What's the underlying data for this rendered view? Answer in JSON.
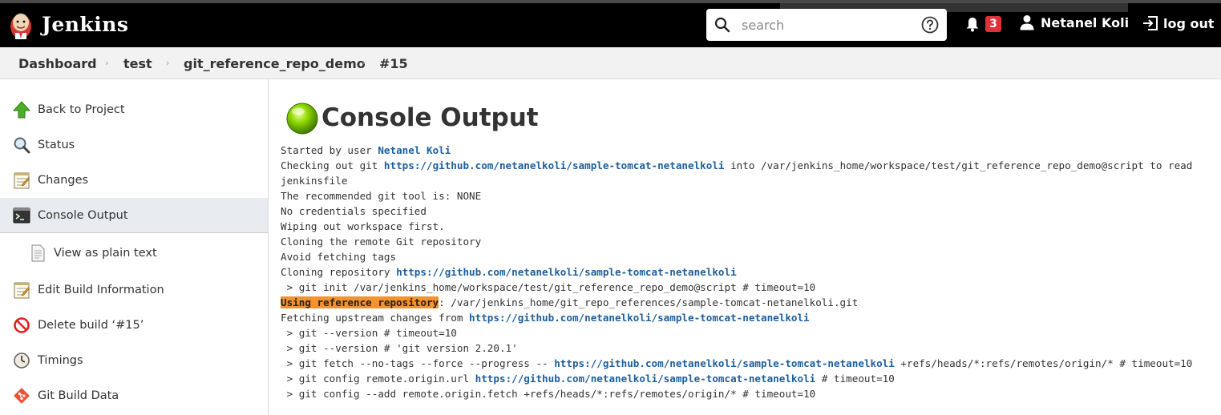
{
  "header": {
    "brand": "Jenkins",
    "search_placeholder": "search",
    "notifications_count": "3",
    "user_name": "Netanel Koli",
    "logout_label": "log out"
  },
  "breadcrumbs": [
    "Dashboard",
    "test",
    "git_reference_repo_demo",
    "#15"
  ],
  "sidebar": {
    "items": [
      {
        "label": "Back to Project",
        "icon": "up-arrow-icon"
      },
      {
        "label": "Status",
        "icon": "magnifier-icon"
      },
      {
        "label": "Changes",
        "icon": "notepad-icon"
      },
      {
        "label": "Console Output",
        "icon": "terminal-icon"
      },
      {
        "label": "View as plain text",
        "icon": "document-icon"
      },
      {
        "label": "Edit Build Information",
        "icon": "notepad-icon"
      },
      {
        "label": "Delete build ‘#15’",
        "icon": "no-entry-icon"
      },
      {
        "label": "Timings",
        "icon": "clock-icon"
      },
      {
        "label": "Git Build Data",
        "icon": "git-icon"
      }
    ]
  },
  "main": {
    "title": "Console Output",
    "status_color": "#76c800"
  },
  "console": {
    "l01_pre": "Started by user ",
    "l01_link": "Netanel Koli",
    "l02_pre": "Checking out git ",
    "l02_link": "https://github.com/netanelkoli/sample-tomcat-netanelkoli",
    "l02_post": " into /var/jenkins_home/workspace/test/git_reference_repo_demo@script to read jenkinsfile",
    "l03": "The recommended git tool is: NONE",
    "l04": "No credentials specified",
    "l05": "Wiping out workspace first.",
    "l06": "Cloning the remote Git repository",
    "l07": "Avoid fetching tags",
    "l08_pre": "Cloning repository ",
    "l08_link": "https://github.com/netanelkoli/sample-tomcat-netanelkoli",
    "l09": " > git init /var/jenkins_home/workspace/test/git_reference_repo_demo@script # timeout=10",
    "l10_hl": "Using reference repository",
    "l10_post": ": /var/jenkins_home/git_repo_references/sample-tomcat-netanelkoli.git",
    "l11_pre": "Fetching upstream changes from ",
    "l11_link": "https://github.com/netanelkoli/sample-tomcat-netanelkoli",
    "l12": " > git --version # timeout=10",
    "l13": " > git --version # 'git version 2.20.1'",
    "l14_pre": " > git fetch --no-tags --force --progress -- ",
    "l14_link": "https://github.com/netanelkoli/sample-tomcat-netanelkoli",
    "l14_post": " +refs/heads/*:refs/remotes/origin/* # timeout=10",
    "l15_pre": " > git config remote.origin.url ",
    "l15_link": "https://github.com/netanelkoli/sample-tomcat-netanelkoli",
    "l15_post": " # timeout=10",
    "l16": " > git config --add remote.origin.fetch +refs/heads/*:refs/remotes/origin/* # timeout=10"
  }
}
